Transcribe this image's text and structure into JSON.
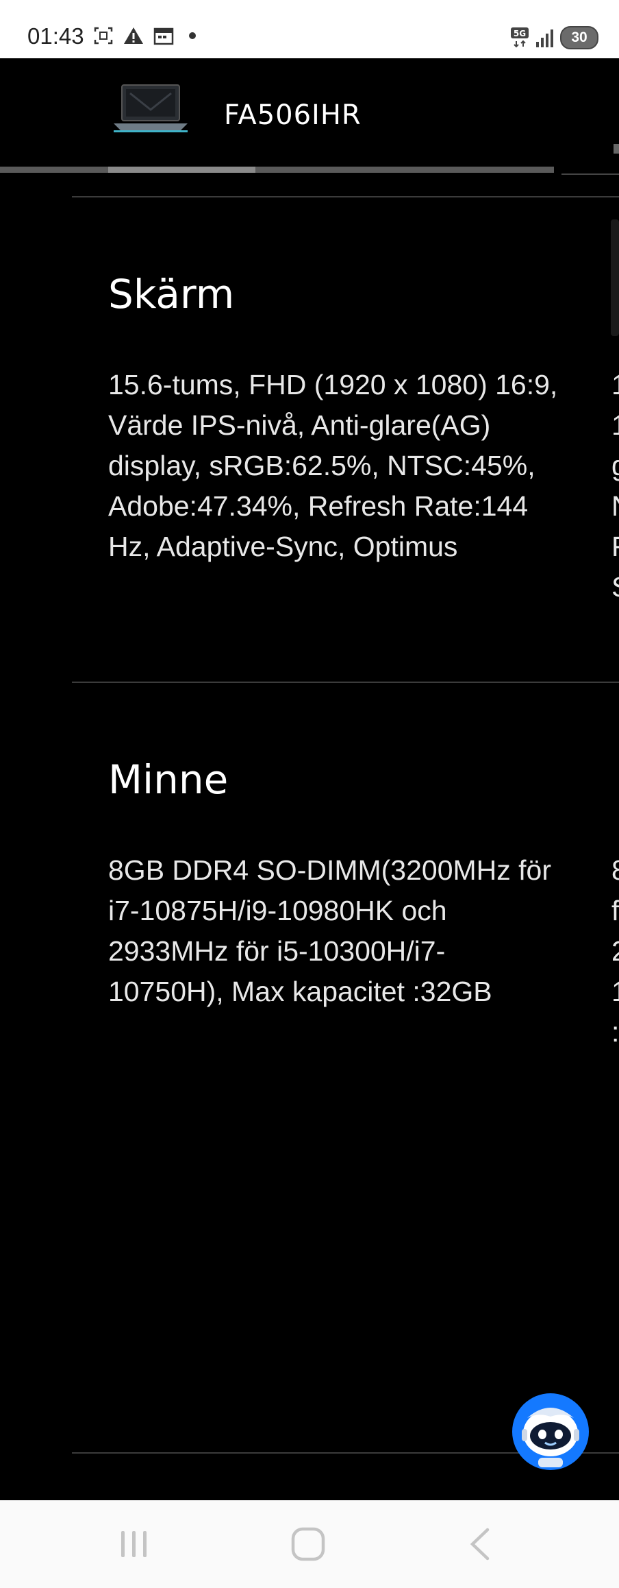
{
  "status_bar": {
    "time": "01:43",
    "network": "5G",
    "battery": "30",
    "icons": [
      "screenshot-icon",
      "warning-icon",
      "calendar-icon",
      "dot-icon",
      "signal-icon",
      "battery-icon"
    ]
  },
  "header": {
    "product_name": "FA506IHR",
    "thumbnail": "laptop-thumbnail",
    "progress": 0.27
  },
  "sections": [
    {
      "title": "Skärm",
      "body": "15.6-tums, FHD (1920 x 1080) 16:9, Värde IPS-nivå, Anti-glare(AG) display, sRGB:62.5%, NTSC:45%, Adobe:47.34%, Refresh Rate:144 Hz, Adaptive-Sync, Optimus",
      "peek_lines": [
        "1",
        "1",
        "g",
        "N",
        "F",
        "S"
      ]
    },
    {
      "title": "Minne",
      "body": "8GB DDR4 SO-DIMM(3200MHz för i7-10875H/i9-10980HK och 2933MHz för i5-10300H/i7-10750H), Max kapacitet :32GB",
      "peek_lines": [
        "8",
        "f",
        "2",
        "1",
        ":"
      ]
    }
  ],
  "chatbot": {
    "icon": "robot-assistant-icon"
  },
  "nav_bar": {
    "buttons": [
      "recents-icon",
      "home-icon",
      "back-icon"
    ]
  },
  "colors": {
    "background": "#000000",
    "chatbot": "#1479ff",
    "text": "#e8e8e8"
  }
}
